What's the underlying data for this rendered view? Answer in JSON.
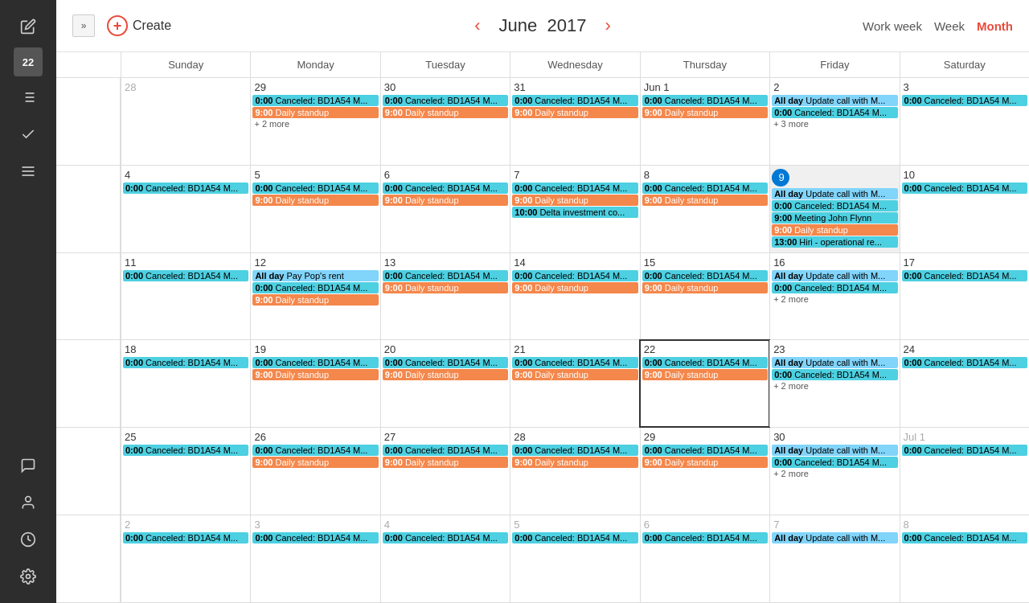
{
  "sidebar": {
    "badge": "22",
    "icons": [
      "edit",
      "list",
      "check",
      "menu",
      "chat",
      "person",
      "clock",
      "settings"
    ]
  },
  "topbar": {
    "create_label": "Create",
    "month_label": "June",
    "year_label": "2017",
    "view_work_week": "Work week",
    "view_week": "Week",
    "view_month": "Month"
  },
  "day_headers": [
    "Sunday",
    "Monday",
    "Tuesday",
    "Wednesday",
    "Thursday",
    "Friday",
    "Saturday"
  ],
  "weeks": [
    {
      "week_num": "",
      "days": [
        {
          "num": "28",
          "other_month": true,
          "events": []
        },
        {
          "num": "29",
          "events": [
            {
              "type": "cyan",
              "time": "0:00",
              "text": "Canceled: BD1A54 M..."
            },
            {
              "type": "orange",
              "time": "9:00",
              "text": "Daily standup"
            },
            {
              "more": "+ 2 more"
            }
          ]
        },
        {
          "num": "30",
          "events": [
            {
              "type": "cyan",
              "time": "0:00",
              "text": "Canceled: BD1A54 M..."
            },
            {
              "type": "orange",
              "time": "9:00",
              "text": "Daily standup"
            }
          ]
        },
        {
          "num": "31",
          "events": [
            {
              "type": "cyan",
              "time": "0:00",
              "text": "Canceled: BD1A54 M..."
            },
            {
              "type": "orange",
              "time": "9:00",
              "text": "Daily standup"
            }
          ]
        },
        {
          "num": "Jun 1",
          "first_of_month": true,
          "events": [
            {
              "type": "cyan",
              "time": "0:00",
              "text": "Canceled: BD1A54 M..."
            },
            {
              "type": "orange",
              "time": "9:00",
              "text": "Daily standup"
            }
          ]
        },
        {
          "num": "2",
          "events": [
            {
              "type": "blue-light",
              "time": "All day",
              "text": "Update call with M..."
            },
            {
              "type": "cyan",
              "time": "0:00",
              "text": "Canceled: BD1A54 M..."
            },
            {
              "more": "+ 3 more"
            }
          ]
        },
        {
          "num": "3",
          "events": [
            {
              "type": "cyan",
              "time": "0:00",
              "text": "Canceled: BD1A54 M..."
            }
          ]
        }
      ]
    },
    {
      "week_num": "",
      "days": [
        {
          "num": "4",
          "events": [
            {
              "type": "cyan",
              "time": "0:00",
              "text": "Canceled: BD1A54 M..."
            }
          ]
        },
        {
          "num": "5",
          "events": [
            {
              "type": "cyan",
              "time": "0:00",
              "text": "Canceled: BD1A54 M..."
            },
            {
              "type": "orange",
              "time": "9:00",
              "text": "Daily standup"
            }
          ]
        },
        {
          "num": "6",
          "events": [
            {
              "type": "cyan",
              "time": "0:00",
              "text": "Canceled: BD1A54 M..."
            },
            {
              "type": "orange",
              "time": "9:00",
              "text": "Daily standup"
            }
          ]
        },
        {
          "num": "7",
          "events": [
            {
              "type": "cyan",
              "time": "0:00",
              "text": "Canceled: BD1A54 M..."
            },
            {
              "type": "orange",
              "time": "9:00",
              "text": "Daily standup"
            },
            {
              "type": "cyan",
              "time": "10:00",
              "text": "Delta investment co..."
            }
          ]
        },
        {
          "num": "8",
          "events": [
            {
              "type": "cyan",
              "time": "0:00",
              "text": "Canceled: BD1A54 M..."
            },
            {
              "type": "orange",
              "time": "9:00",
              "text": "Daily standup"
            }
          ]
        },
        {
          "num": "9",
          "today": true,
          "events": [
            {
              "type": "blue-light",
              "time": "All day",
              "text": "Update call with M..."
            },
            {
              "type": "cyan",
              "time": "0:00",
              "text": "Canceled: BD1A54 M..."
            },
            {
              "type": "cyan",
              "time": "9:00",
              "text": "Meeting John Flynn"
            },
            {
              "type": "orange",
              "time": "9:00",
              "text": "Daily standup"
            },
            {
              "type": "cyan",
              "time": "13:00",
              "text": "Hiri - operational re..."
            }
          ]
        },
        {
          "num": "10",
          "events": [
            {
              "type": "cyan",
              "time": "0:00",
              "text": "Canceled: BD1A54 M..."
            }
          ]
        }
      ]
    },
    {
      "week_num": "",
      "days": [
        {
          "num": "11",
          "events": [
            {
              "type": "cyan",
              "time": "0:00",
              "text": "Canceled: BD1A54 M..."
            }
          ]
        },
        {
          "num": "12",
          "events": [
            {
              "type": "blue-light",
              "time": "All day",
              "text": "Pay Pop's rent"
            },
            {
              "type": "cyan",
              "time": "0:00",
              "text": "Canceled: BD1A54 M..."
            },
            {
              "type": "orange",
              "time": "9:00",
              "text": "Daily standup"
            }
          ]
        },
        {
          "num": "13",
          "events": [
            {
              "type": "cyan",
              "time": "0:00",
              "text": "Canceled: BD1A54 M..."
            },
            {
              "type": "orange",
              "time": "9:00",
              "text": "Daily standup"
            }
          ]
        },
        {
          "num": "14",
          "events": [
            {
              "type": "cyan",
              "time": "0:00",
              "text": "Canceled: BD1A54 M..."
            },
            {
              "type": "orange",
              "time": "9:00",
              "text": "Daily standup"
            }
          ]
        },
        {
          "num": "15",
          "events": [
            {
              "type": "cyan",
              "time": "0:00",
              "text": "Canceled: BD1A54 M..."
            },
            {
              "type": "orange",
              "time": "9:00",
              "text": "Daily standup"
            }
          ]
        },
        {
          "num": "16",
          "events": [
            {
              "type": "blue-light",
              "time": "All day",
              "text": "Update call with M..."
            },
            {
              "type": "cyan",
              "time": "0:00",
              "text": "Canceled: BD1A54 M..."
            },
            {
              "more": "+ 2 more"
            }
          ]
        },
        {
          "num": "17",
          "events": [
            {
              "type": "cyan",
              "time": "0:00",
              "text": "Canceled: BD1A54 M..."
            }
          ]
        }
      ]
    },
    {
      "week_num": "",
      "days": [
        {
          "num": "18",
          "events": [
            {
              "type": "cyan",
              "time": "0:00",
              "text": "Canceled: BD1A54 M..."
            }
          ]
        },
        {
          "num": "19",
          "events": [
            {
              "type": "cyan",
              "time": "0:00",
              "text": "Canceled: BD1A54 M..."
            },
            {
              "type": "orange",
              "time": "9:00",
              "text": "Daily standup"
            }
          ]
        },
        {
          "num": "20",
          "events": [
            {
              "type": "cyan",
              "time": "0:00",
              "text": "Canceled: BD1A54 M..."
            },
            {
              "type": "orange",
              "time": "9:00",
              "text": "Daily standup"
            }
          ]
        },
        {
          "num": "21",
          "events": [
            {
              "type": "cyan",
              "time": "0:00",
              "text": "Canceled: BD1A54 M..."
            },
            {
              "type": "orange",
              "time": "9:00",
              "text": "Daily standup"
            }
          ]
        },
        {
          "num": "22",
          "highlighted": true,
          "events": [
            {
              "type": "cyan",
              "time": "0:00",
              "text": "Canceled: BD1A54 M..."
            },
            {
              "type": "orange",
              "time": "9:00",
              "text": "Daily standup"
            }
          ]
        },
        {
          "num": "23",
          "events": [
            {
              "type": "blue-light",
              "time": "All day",
              "text": "Update call with M..."
            },
            {
              "type": "cyan",
              "time": "0:00",
              "text": "Canceled: BD1A54 M..."
            },
            {
              "more": "+ 2 more"
            }
          ]
        },
        {
          "num": "24",
          "events": [
            {
              "type": "cyan",
              "time": "0:00",
              "text": "Canceled: BD1A54 M..."
            }
          ]
        }
      ]
    },
    {
      "week_num": "",
      "days": [
        {
          "num": "25",
          "events": [
            {
              "type": "cyan",
              "time": "0:00",
              "text": "Canceled: BD1A54 M..."
            }
          ]
        },
        {
          "num": "26",
          "events": [
            {
              "type": "cyan",
              "time": "0:00",
              "text": "Canceled: BD1A54 M..."
            },
            {
              "type": "orange",
              "time": "9:00",
              "text": "Daily standup"
            }
          ]
        },
        {
          "num": "27",
          "events": [
            {
              "type": "cyan",
              "time": "0:00",
              "text": "Canceled: BD1A54 M..."
            },
            {
              "type": "orange",
              "time": "9:00",
              "text": "Daily standup"
            }
          ]
        },
        {
          "num": "28",
          "events": [
            {
              "type": "cyan",
              "time": "0:00",
              "text": "Canceled: BD1A54 M..."
            },
            {
              "type": "orange",
              "time": "9:00",
              "text": "Daily standup"
            }
          ]
        },
        {
          "num": "29",
          "events": [
            {
              "type": "cyan",
              "time": "0:00",
              "text": "Canceled: BD1A54 M..."
            },
            {
              "type": "orange",
              "time": "9:00",
              "text": "Daily standup"
            }
          ]
        },
        {
          "num": "30",
          "events": [
            {
              "type": "blue-light",
              "time": "All day",
              "text": "Update call with M..."
            },
            {
              "type": "cyan",
              "time": "0:00",
              "text": "Canceled: BD1A54 M..."
            },
            {
              "more": "+ 2 more"
            }
          ]
        },
        {
          "num": "Jul 1",
          "other_month": true,
          "events": [
            {
              "type": "cyan",
              "time": "0:00",
              "text": "Canceled: BD1A54 M..."
            }
          ]
        }
      ]
    },
    {
      "week_num": "",
      "partial": true,
      "days": [
        {
          "num": "2",
          "other_month": true,
          "events": [
            {
              "type": "cyan",
              "time": "0:00",
              "text": "Canceled: BD1A54 M..."
            }
          ]
        },
        {
          "num": "3",
          "other_month": true,
          "events": [
            {
              "type": "cyan",
              "time": "0:00",
              "text": "Canceled: BD1A54 M..."
            }
          ]
        },
        {
          "num": "4",
          "other_month": true,
          "events": [
            {
              "type": "cyan",
              "time": "0:00",
              "text": "Canceled: BD1A54 M..."
            }
          ]
        },
        {
          "num": "5",
          "other_month": true,
          "events": [
            {
              "type": "cyan",
              "time": "0:00",
              "text": "Canceled: BD1A54 M..."
            }
          ]
        },
        {
          "num": "6",
          "other_month": true,
          "events": [
            {
              "type": "cyan",
              "time": "0:00",
              "text": "Canceled: BD1A54 M..."
            }
          ]
        },
        {
          "num": "7",
          "other_month": true,
          "events": [
            {
              "type": "blue-light",
              "time": "All day",
              "text": "Update call with M..."
            }
          ]
        },
        {
          "num": "8",
          "other_month": true,
          "events": [
            {
              "type": "cyan",
              "time": "0:00",
              "text": "Canceled: BD1A54 M..."
            }
          ]
        }
      ]
    }
  ]
}
